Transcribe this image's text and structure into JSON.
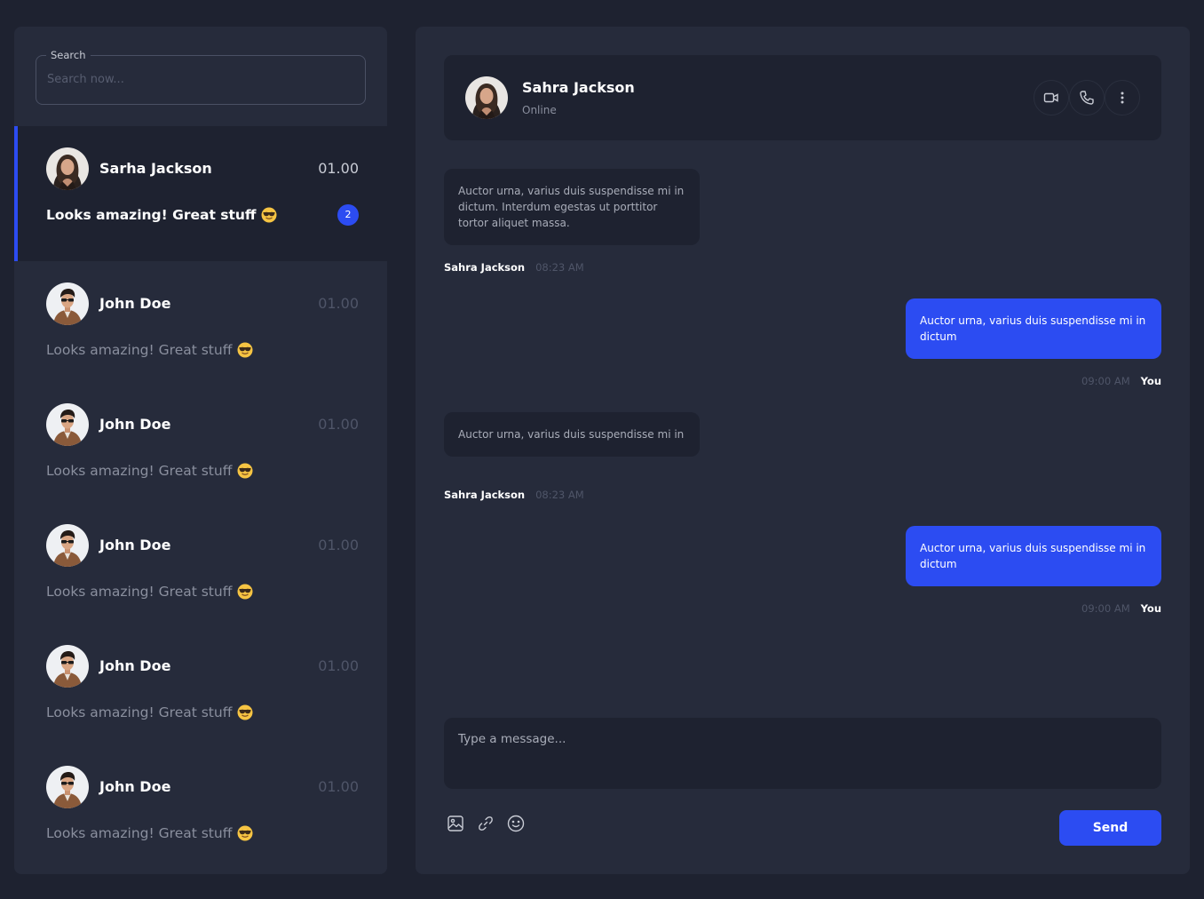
{
  "sidebar": {
    "search": {
      "label": "Search",
      "placeholder": "Search now..."
    },
    "chats": [
      {
        "name": "Sarha Jackson",
        "time": "01.00",
        "preview": "Looks amazing! Great stuff",
        "unread": "2",
        "avatar": "woman-avatar",
        "active": true
      },
      {
        "name": "John Doe",
        "time": "01.00",
        "preview": "Looks amazing! Great stuff",
        "avatar": "man-avatar"
      },
      {
        "name": "John Doe",
        "time": "01.00",
        "preview": "Looks amazing! Great stuff",
        "avatar": "man-avatar"
      },
      {
        "name": "John Doe",
        "time": "01.00",
        "preview": "Looks amazing! Great stuff",
        "avatar": "man-avatar"
      },
      {
        "name": "John Doe",
        "time": "01.00",
        "preview": "Looks amazing! Great stuff",
        "avatar": "man-avatar"
      },
      {
        "name": "John Doe",
        "time": "01.00",
        "preview": "Looks amazing! Great stuff",
        "avatar": "man-avatar"
      }
    ],
    "preview_emoji": "sunglasses-emoji-icon"
  },
  "conversation": {
    "header": {
      "name": "Sahra Jackson",
      "status": "Online",
      "actions": [
        "video-call-icon",
        "phone-icon",
        "more-vertical-icon"
      ]
    },
    "messages": [
      {
        "direction": "in",
        "text": "Auctor urna, varius duis suspendisse mi in dictum. Interdum egestas ut porttitor tortor aliquet massa.",
        "sender": "Sahra Jackson",
        "time": "08:23 AM"
      },
      {
        "direction": "out",
        "text": "Auctor urna, varius duis suspendisse mi in dictum",
        "sender": "You",
        "time": "09:00 AM"
      },
      {
        "direction": "in",
        "text": "Auctor urna, varius duis suspendisse mi in",
        "sender": "Sahra Jackson",
        "time": "08:23 AM"
      },
      {
        "direction": "out",
        "text": "Auctor urna, varius duis suspendisse mi in dictum",
        "sender": "You",
        "time": "09:00 AM"
      }
    ],
    "composer": {
      "placeholder": "Type a message...",
      "tools": [
        "image-icon",
        "link-icon",
        "emoji-icon"
      ],
      "send_label": "Send"
    }
  },
  "colors": {
    "background": "#1e2230",
    "panel": "#262b3b",
    "accent": "#2c4cf2",
    "muted_text": "#8a8f9e"
  }
}
